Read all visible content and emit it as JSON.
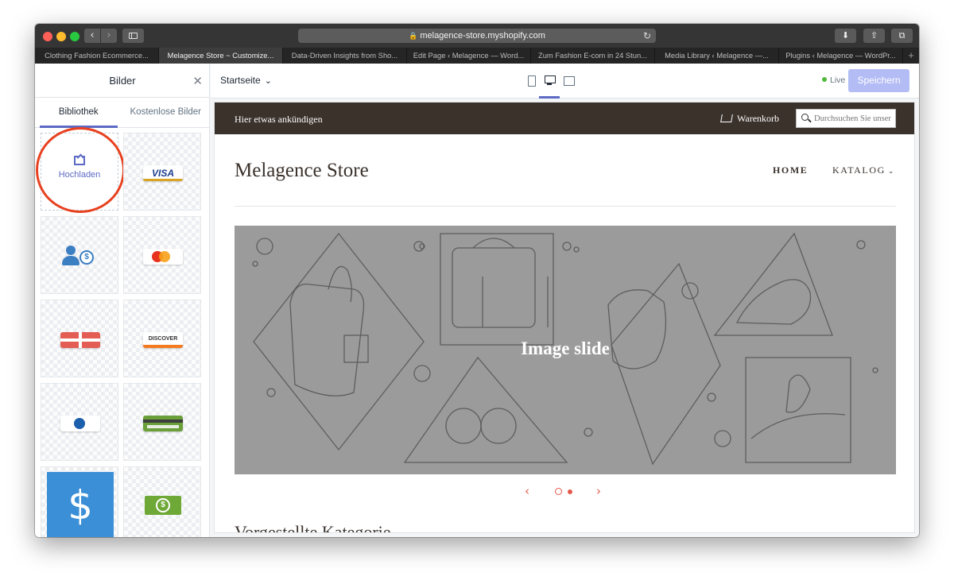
{
  "browser": {
    "url": "melagence-store.myshopify.com",
    "tabs": [
      {
        "label": "Clothing Fashion Ecommerce...",
        "active": false
      },
      {
        "label": "Melagence Store ~ Customize...",
        "active": true
      },
      {
        "label": "Data-Driven Insights from Sho...",
        "active": false
      },
      {
        "label": "Edit Page ‹ Melagence — Word...",
        "active": false
      },
      {
        "label": "Zum Fashion E-com in 24 Stun...",
        "active": false
      },
      {
        "label": "Media Library ‹ Melagence —...",
        "active": false
      },
      {
        "label": "Plugins ‹ Melagence — WordPr...",
        "active": false
      }
    ]
  },
  "panel": {
    "title": "Bilder",
    "tabs": [
      "Bibliothek",
      "Kostenlose Bilder"
    ],
    "upload_label": "Hochladen",
    "visa_text": "VISA",
    "discover_text": "DISCOVER",
    "images": [
      "visa-card",
      "customer-payment",
      "mastercard",
      "gift-card",
      "discover-card",
      "diners-club-card",
      "green-credit-card",
      "dollar-sign",
      "dollar-bill"
    ]
  },
  "topbar": {
    "page_selector": "Startseite",
    "status": "Live",
    "save_label": "Speichern"
  },
  "preview": {
    "announcement": "Hier etwas ankündigen",
    "cart_label": "Warenkorb",
    "search_placeholder": "Durchsuchen Sie unser",
    "store_name": "Melagence Store",
    "nav": [
      "HOME",
      "KATALOG"
    ],
    "slide_text": "Image slide",
    "featured_heading": "Vorgestellte Kategorie"
  },
  "colors": {
    "accent": "#5c6ac4",
    "save_button": "#b3bcf5",
    "announcement_bar": "#3b322c",
    "slide_background": "#9b9b9b",
    "highlight_circle": "#e8411f",
    "slider_controls": "#e4584a"
  }
}
